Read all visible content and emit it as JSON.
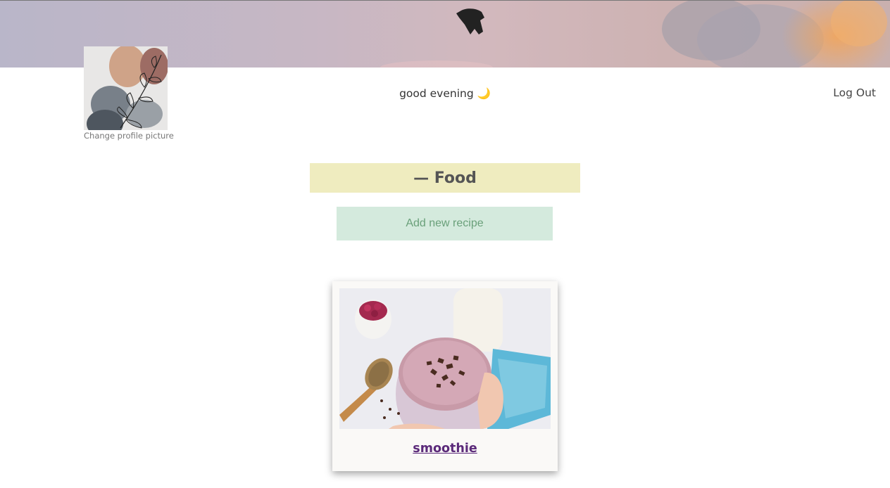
{
  "header": {
    "change_picture_label": "Change profile picture",
    "greeting": "good evening 🌙",
    "logout_label": "Log Out"
  },
  "main": {
    "category_title": "— Food",
    "add_recipe_label": "Add new recipe",
    "recipes": [
      {
        "title": "smoothie"
      }
    ]
  },
  "colors": {
    "category_bg": "#efecbf",
    "add_button_bg": "#d4eadd",
    "add_button_text": "#6aa07a",
    "recipe_link": "#5b2a7a"
  }
}
